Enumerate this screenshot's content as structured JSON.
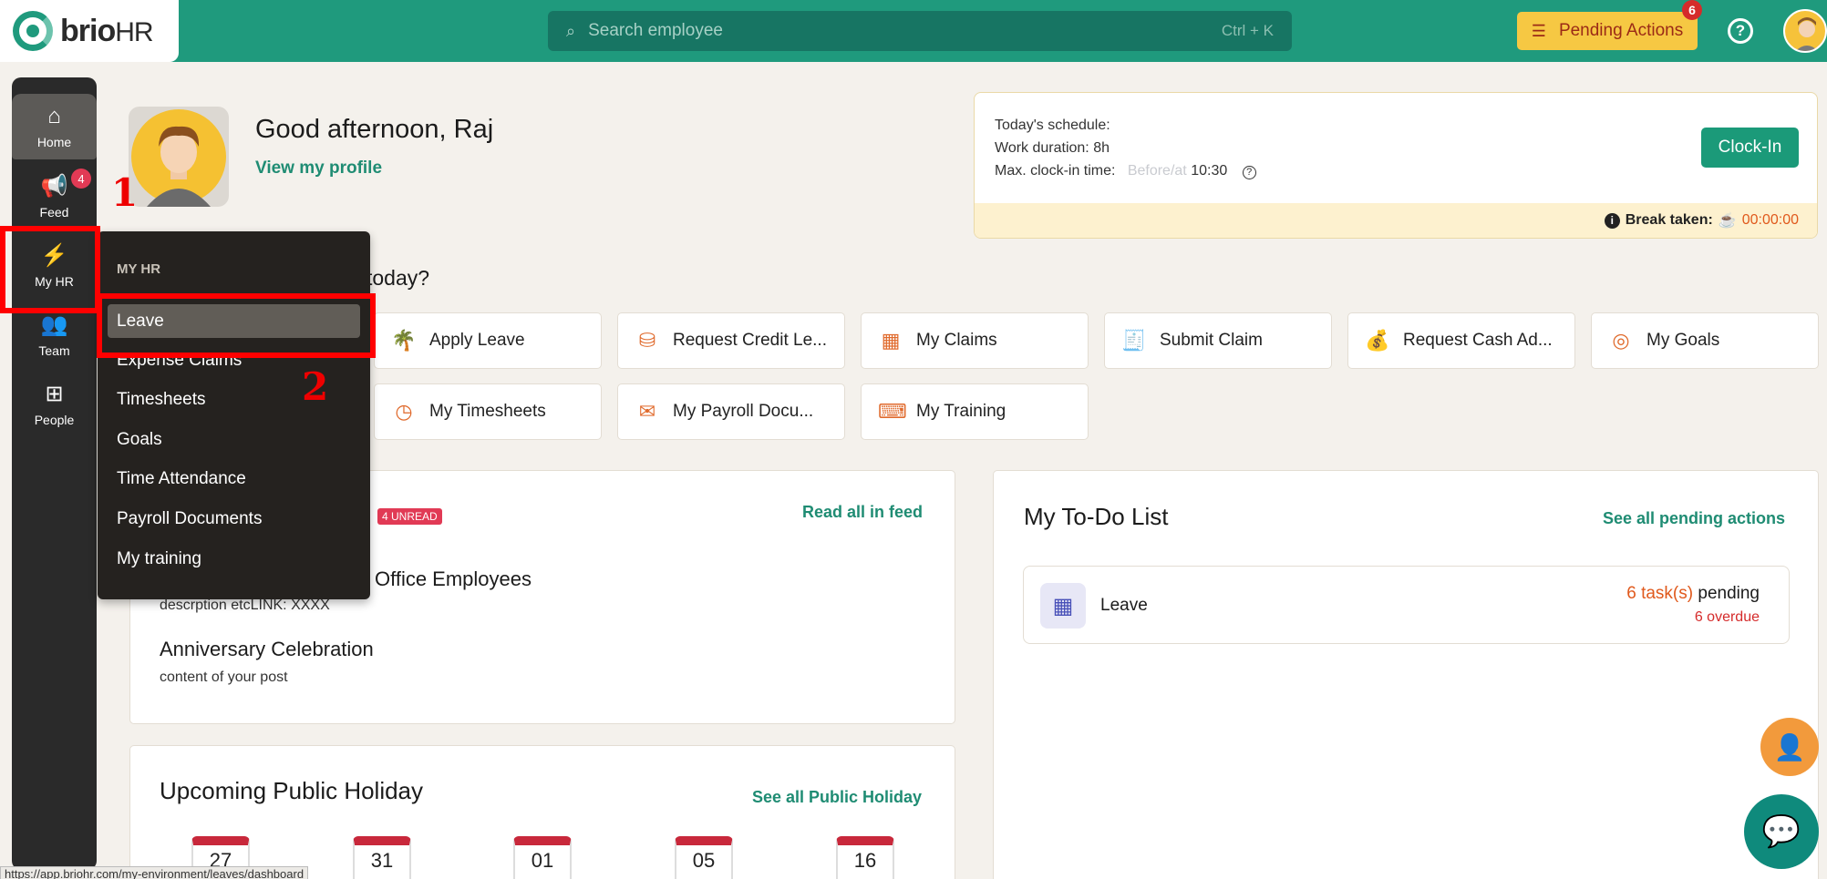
{
  "brand": {
    "name": "brio",
    "suffix": "HR"
  },
  "topbar": {
    "search_placeholder": "Search employee",
    "search_shortcut": "Ctrl + K",
    "pending_label": "Pending Actions",
    "pending_count": "6",
    "help_label": "?"
  },
  "sidebar": {
    "items": [
      {
        "label": "Home",
        "icon": "home-icon"
      },
      {
        "label": "Feed",
        "icon": "megaphone-icon",
        "badge": "4"
      },
      {
        "label": "My HR",
        "icon": "lightning-icon"
      },
      {
        "label": "Team",
        "icon": "team-icon"
      },
      {
        "label": "People",
        "icon": "org-chart-icon"
      }
    ]
  },
  "annotations": {
    "step1": "1",
    "step2": "2"
  },
  "greeting": {
    "text": "Good afternoon, Raj",
    "profile_link": "View my profile"
  },
  "schedule": {
    "line1": "Today's schedule:",
    "line2": "Work duration: 8h",
    "line3_label": "Max. clock-in time:",
    "line3_hint": "Before/at",
    "line3_value": "10:30",
    "clockin_label": "Clock-In",
    "break_label": "Break taken:",
    "break_value": "00:00:00"
  },
  "quick_actions": {
    "question": "today?",
    "items": [
      "Apply Leave",
      "Request Credit Le...",
      "My Claims",
      "Submit Claim",
      "Request Cash Ad...",
      "My Goals",
      "My Timesheets",
      "My Payroll Docu...",
      "My Training"
    ]
  },
  "feed": {
    "unread": "4 UNREAD",
    "read_all": "Read all in feed",
    "post1_title": "Office Employees",
    "post1_sub": "descrption etcLINK: XXXX",
    "post2_title": "Anniversary Celebration",
    "post2_sub": "content of your post"
  },
  "todo": {
    "title": "My To-Do List",
    "see_all": "See all pending actions",
    "item_label": "Leave",
    "task_count": "6 task(s)",
    "task_suffix": "pending",
    "overdue": "6 overdue"
  },
  "holiday": {
    "title": "Upcoming Public Holiday",
    "see_all": "See all Public Holiday",
    "days": [
      "27",
      "31",
      "01",
      "05",
      "16"
    ]
  },
  "menu": {
    "header": "MY HR",
    "items": [
      "Leave",
      "Expense Claims",
      "Timesheets",
      "Goals",
      "Time Attendance",
      "Payroll Documents",
      "My training"
    ]
  },
  "status_url": "https://app.briohr.com/my-environment/leaves/dashboard",
  "colors": {
    "brand": "#1f9a7d",
    "accent": "#e0591c",
    "annotation": "#ff0000"
  }
}
